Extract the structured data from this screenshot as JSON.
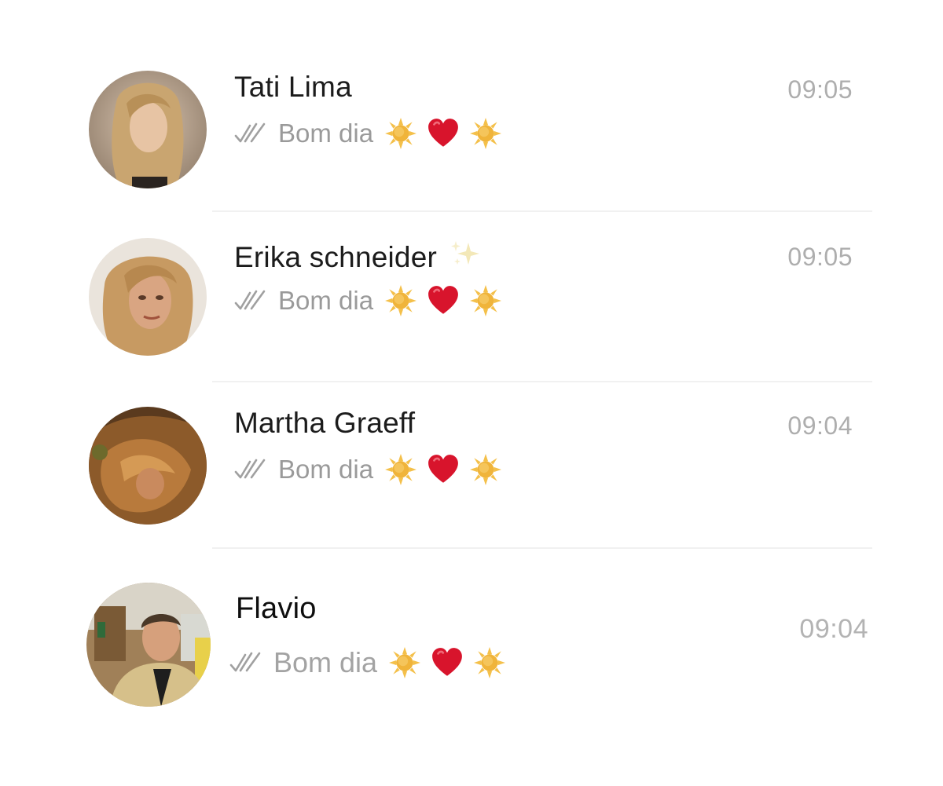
{
  "chats": [
    {
      "name": "Tati Lima",
      "time": "09:05",
      "preview": "Bom dia",
      "read_status_icon": "double-check-icon",
      "emojis": [
        "sun-icon",
        "red-heart-icon",
        "sun-icon"
      ],
      "avatar": "profile-photo"
    },
    {
      "name": "Erika schneider",
      "name_icon": "sparkles-icon",
      "time": "09:05",
      "preview": "Bom dia",
      "read_status_icon": "double-check-icon",
      "emojis": [
        "sun-icon",
        "red-heart-icon",
        "sun-icon"
      ],
      "avatar": "profile-photo"
    },
    {
      "name": "Martha Graeff",
      "time": "09:04",
      "preview": "Bom dia",
      "read_status_icon": "double-check-icon",
      "emojis": [
        "sun-icon",
        "red-heart-icon",
        "sun-icon"
      ],
      "avatar": "profile-photo"
    },
    {
      "name": "Flavio",
      "time": "09:04",
      "preview": "Bom dia",
      "read_status_icon": "double-check-icon",
      "emojis": [
        "sun-icon",
        "red-heart-icon",
        "sun-icon"
      ],
      "avatar": "profile-photo"
    }
  ],
  "colors": {
    "name_text": "#1c1c1c",
    "preview_text": "#9a9a9a",
    "timestamp_text": "#aeaeae",
    "check_marks": "#a0a0a0",
    "sun": "#f2b93b",
    "heart": "#d9122b",
    "divider": "#f1f1f1"
  }
}
